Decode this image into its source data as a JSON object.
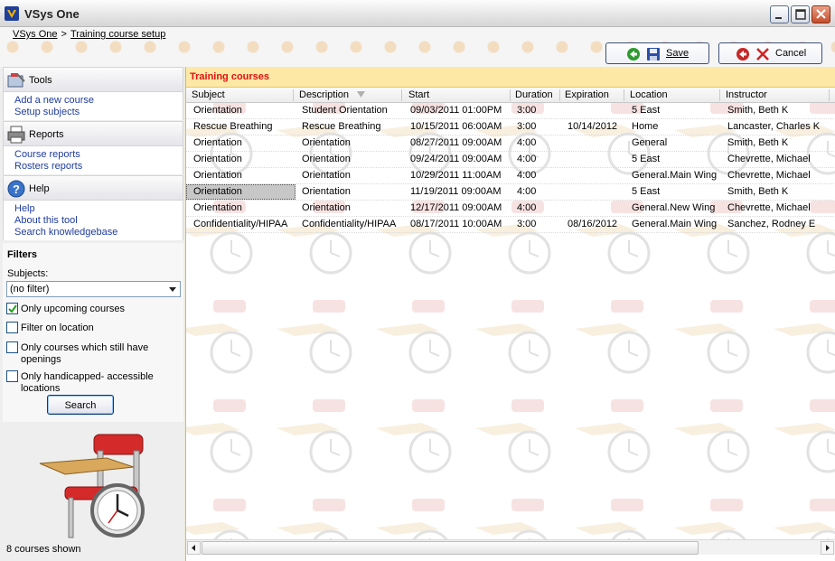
{
  "window": {
    "title": "VSys One"
  },
  "breadcrumb": {
    "home": "VSys One",
    "separator": ">",
    "current": "Training course setup"
  },
  "toolbar": {
    "save_label": "Save",
    "cancel_label": "Cancel"
  },
  "sidebar": {
    "tools": {
      "title": "Tools",
      "links": [
        "Add a new course",
        "Setup subjects"
      ]
    },
    "reports": {
      "title": "Reports",
      "links": [
        "Course reports",
        "Rosters reports"
      ]
    },
    "help": {
      "title": "Help",
      "links": [
        "Help",
        "About this tool",
        "Search knowledgebase"
      ]
    },
    "filters": {
      "title": "Filters",
      "subjects_label": "Subjects:",
      "subjects_value": "(no filter)",
      "options": [
        {
          "label": "Only upcoming courses",
          "checked": true
        },
        {
          "label": "Filter on location",
          "checked": false
        },
        {
          "label": "Only courses which still have openings",
          "checked": false
        },
        {
          "label": "Only handicapped- accessible locations",
          "checked": false
        }
      ],
      "search_label": "Search"
    },
    "status": "8 courses shown"
  },
  "panel": {
    "title": "Training courses"
  },
  "table": {
    "columns": [
      "Subject",
      "Description",
      "Start",
      "Duration",
      "Expiration",
      "Location",
      "Instructor"
    ],
    "sorted_column": "Description",
    "selected_row": 5,
    "rows": [
      [
        "Orientation",
        "Student Orientation",
        "09/03/2011 01:00PM",
        "3:00",
        "",
        "5 East",
        "Smith, Beth K"
      ],
      [
        "Rescue Breathing",
        "Rescue Breathing",
        "10/15/2011 06:00AM",
        "3:00",
        "10/14/2012",
        "Home",
        "Lancaster, Charles K"
      ],
      [
        "Orientation",
        "Orientation",
        "08/27/2011 09:00AM",
        "4:00",
        "",
        "General",
        "Smith, Beth K"
      ],
      [
        "Orientation",
        "Orientation",
        "09/24/2011 09:00AM",
        "4:00",
        "",
        "5 East",
        "Chevrette, Michael"
      ],
      [
        "Orientation",
        "Orientation",
        "10/29/2011 11:00AM",
        "4:00",
        "",
        "General.Main Wing",
        "Chevrette, Michael"
      ],
      [
        "Orientation",
        "Orientation",
        "11/19/2011 09:00AM",
        "4:00",
        "",
        "5 East",
        "Smith, Beth K"
      ],
      [
        "Orientation",
        "Orientation",
        "12/17/2011 09:00AM",
        "4:00",
        "",
        "General.New Wing",
        "Chevrette, Michael"
      ],
      [
        "Confidentiality/HIPAA",
        "Confidentiality/HIPAA",
        "08/17/2011 10:00AM",
        "3:00",
        "08/16/2012",
        "General.Main Wing",
        "Sanchez, Rodney E"
      ]
    ]
  },
  "colors": {
    "panel_title": "#e01010",
    "panel_bg": "#fde8a6",
    "link": "#1e3c9e",
    "selection": "#c7c7c7"
  },
  "icons": [
    "app-logo-icon",
    "minimize-icon",
    "maximize-icon",
    "close-icon",
    "save-arrow-icon",
    "floppy-icon",
    "cancel-arrow-icon",
    "red-x-icon",
    "tools-icon",
    "printer-icon",
    "help-icon",
    "dropdown-arrow-icon",
    "checkmark-icon",
    "chair-clock-icon",
    "sort-arrow-icon",
    "scroll-left-icon",
    "scroll-right-icon"
  ]
}
